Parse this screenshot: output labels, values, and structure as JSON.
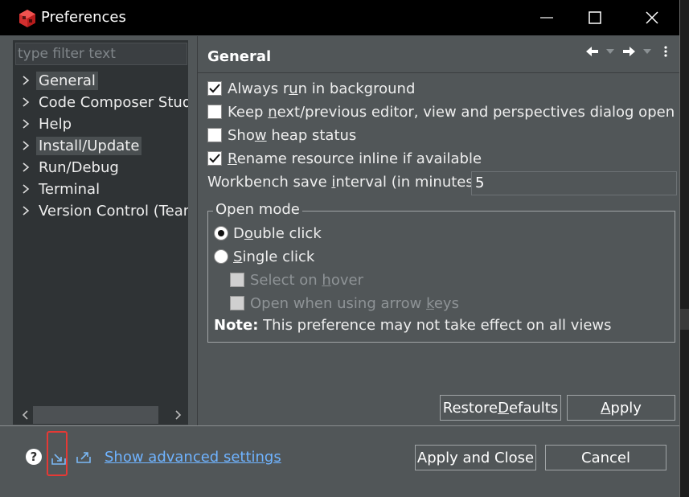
{
  "window": {
    "title": "Preferences",
    "brand_color": "#d32f2f"
  },
  "sidebar": {
    "filter_placeholder": "type filter text",
    "items": [
      {
        "label": "General",
        "selected": true
      },
      {
        "label": "Code Composer Studio"
      },
      {
        "label": "Help"
      },
      {
        "label": "Install/Update",
        "selected": true
      },
      {
        "label": "Run/Debug"
      },
      {
        "label": "Terminal"
      },
      {
        "label": "Version Control (Team)"
      }
    ]
  },
  "page": {
    "title": "General",
    "options": [
      {
        "pre": "Always r",
        "mn": "u",
        "post": "n in background",
        "checked": true
      },
      {
        "pre": "Keep ",
        "mn": "n",
        "post": "ext/previous editor, view and perspectives dialog open",
        "checked": false
      },
      {
        "pre": "Sho",
        "mn": "w",
        "post": " heap status",
        "checked": false
      },
      {
        "pre": "",
        "mn": "R",
        "post": "ename resource inline if available",
        "checked": true
      }
    ],
    "interval": {
      "pre": "Workbench save ",
      "mn": "i",
      "post": "nterval (in minutes):",
      "value": "5"
    },
    "open_mode": {
      "legend": "Open mode",
      "double": {
        "pre": "D",
        "mn": "o",
        "post": "uble click",
        "selected": true
      },
      "single": {
        "pre": "",
        "mn": "S",
        "post": "ingle click",
        "selected": false
      },
      "hover": {
        "pre": "Select on ",
        "mn": "h",
        "post": "over"
      },
      "arrow": {
        "pre": "Open when using arrow ",
        "mn": "k",
        "post": "eys"
      },
      "note_bold": "Note:",
      "note_text": " This preference may not take effect on all views"
    },
    "restore": {
      "pre": "Restore ",
      "mn": "D",
      "post": "efaults"
    },
    "apply": {
      "pre": "",
      "mn": "A",
      "post": "pply"
    }
  },
  "footer": {
    "help_symbol": "?",
    "advanced_link": "Show advanced settings",
    "apply_close": "Apply and Close",
    "cancel": "Cancel"
  }
}
